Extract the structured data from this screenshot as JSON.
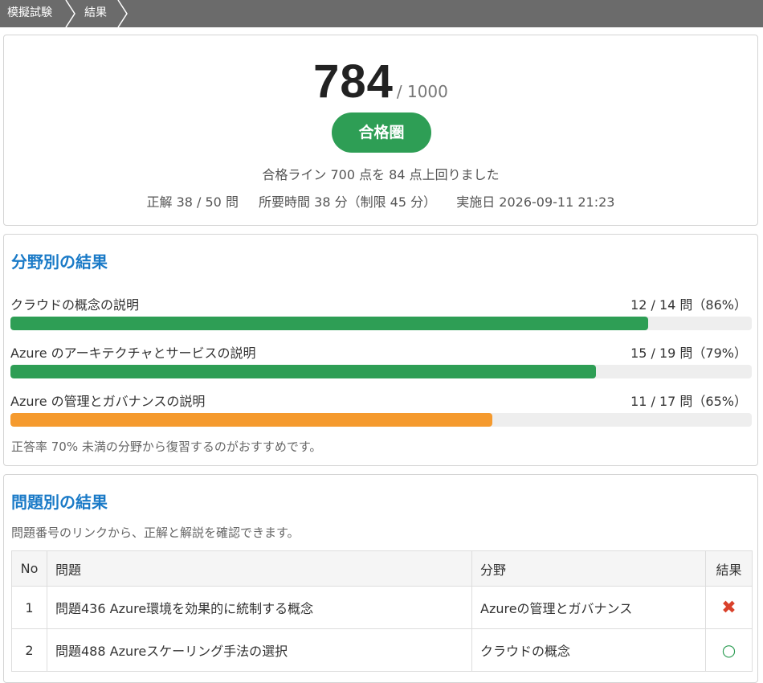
{
  "breadcrumb": {
    "items": [
      "模擬試験",
      "結果"
    ]
  },
  "score": {
    "value": "784",
    "max": "/ 1000",
    "badge": "合格圏",
    "badge_color": "#2e9e55",
    "pass_note": "合格ライン 700 点を 84 点上回りました",
    "correct": "正解 38 / 50 問",
    "time": "所要時間 38 分（制限 45 分）",
    "date": "実施日 2026-09-11 21:23"
  },
  "fields": {
    "title": "分野別の結果",
    "items": [
      {
        "name": "クラウドの概念の説明",
        "score": "12 / 14 問（86%）",
        "rate": 0.86,
        "color": "#2e9e55"
      },
      {
        "name": "Azure のアーキテクチャとサービスの説明",
        "score": "15 / 19 問（79%）",
        "rate": 0.79,
        "color": "#2e9e55"
      },
      {
        "name": "Azure の管理とガバナンスの説明",
        "score": "11 / 17 問（65%）",
        "rate": 0.65,
        "color": "#f59a2e"
      }
    ],
    "hint": "正答率 70% 未満の分野から復習するのがおすすめです。"
  },
  "questions": {
    "title": "問題別の結果",
    "hint": "問題番号のリンクから、正解と解説を確認できます。",
    "columns": {
      "no": "No",
      "question": "問題",
      "field": "分野",
      "result": "結果"
    },
    "rows": [
      {
        "no": "1",
        "question": "問題436 Azure環境を効果的に統制する概念",
        "field": "Azureの管理とガバナンス",
        "result": "✖",
        "result_icon": "cross-icon"
      },
      {
        "no": "2",
        "question": "問題488 Azureスケーリング手法の選択",
        "field": "クラウドの概念",
        "result": "○",
        "result_icon": "circle-icon"
      }
    ]
  }
}
